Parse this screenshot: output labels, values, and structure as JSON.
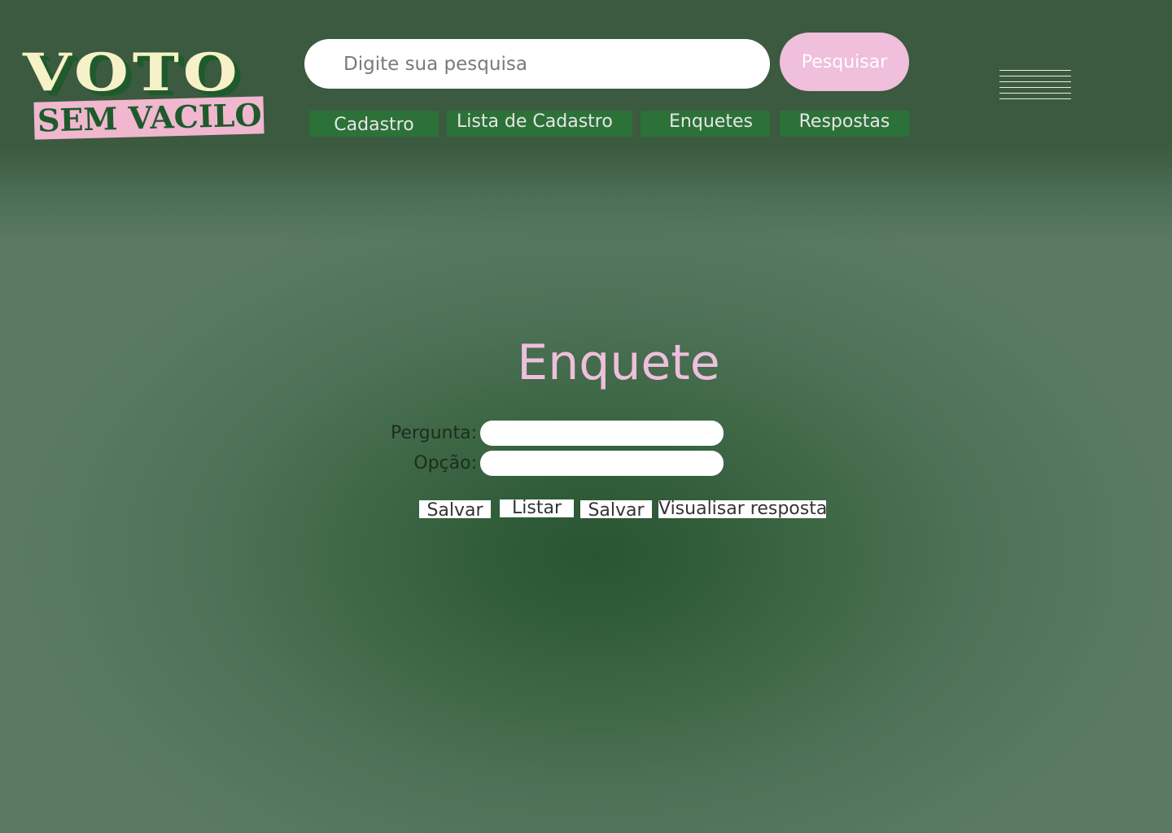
{
  "logo": {
    "line1": "VOTO",
    "line2": "SEM VACILO"
  },
  "search": {
    "placeholder": "Digite sua pesquisa",
    "value": "",
    "button_label": "Pesquisar"
  },
  "nav": {
    "tabs": [
      {
        "label": "Cadastro"
      },
      {
        "label": "Lista de Cadastro"
      },
      {
        "label": "Enquetes"
      },
      {
        "label": "Respostas"
      }
    ]
  },
  "main": {
    "title": "Enquete",
    "form": {
      "question_label": "Pergunta:",
      "question_value": "",
      "option_label": "Opção:",
      "option_value": ""
    },
    "actions": [
      {
        "label": "Salvar"
      },
      {
        "label": "Listar"
      },
      {
        "label": "Salvar"
      },
      {
        "label": "Visualisar resposta"
      }
    ]
  },
  "icons": {
    "menu": "hamburger-menu-icon"
  },
  "colors": {
    "header_bg": "#3b5a3f",
    "page_bg": "#5c7a63",
    "accent_pink": "#efbfdc",
    "nav_tab_bg": "#2c7138",
    "logo_cream": "#f6f1c6",
    "logo_green": "#1e5a2c"
  }
}
